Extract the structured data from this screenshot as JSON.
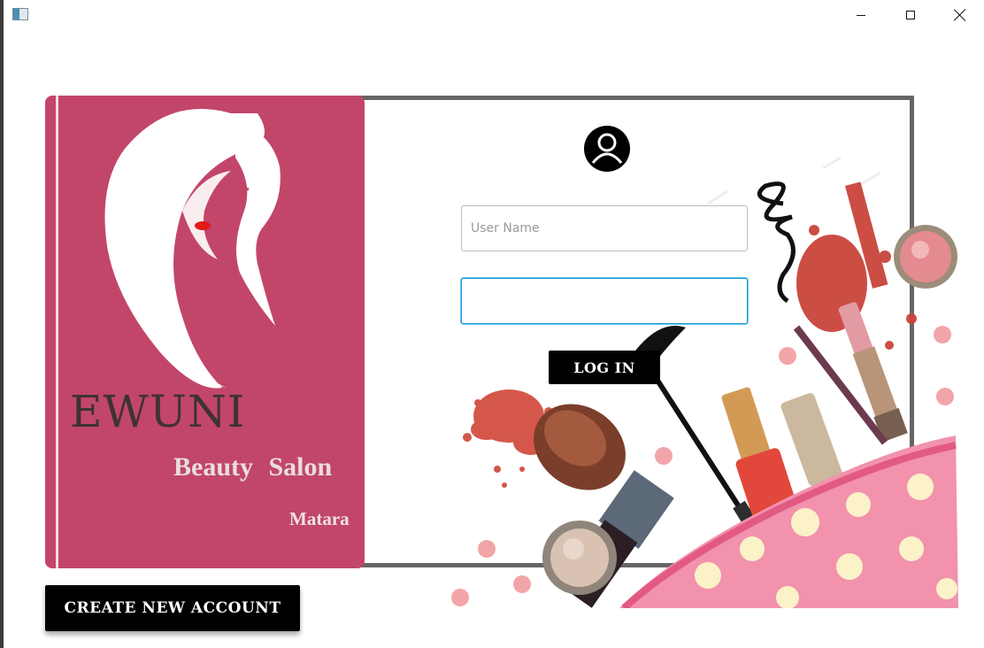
{
  "window": {
    "icon": "app-window-icon",
    "controls": [
      "minimize",
      "maximize",
      "close"
    ]
  },
  "brand": {
    "name": "EWUNI",
    "tagline": "Beauty Salon",
    "city": "Matara",
    "panel_color": "#c2466a"
  },
  "login": {
    "username_placeholder": "User Name",
    "username_value": "",
    "password_value": "",
    "login_label": "LOG IN"
  },
  "footer": {
    "create_account_label": "CREATE NEW ACCOUNT"
  },
  "icons": {
    "avatar": "user-avatar-icon",
    "portrait": "woman-portrait-logo",
    "art": "makeup-cosmetics-illustration"
  }
}
